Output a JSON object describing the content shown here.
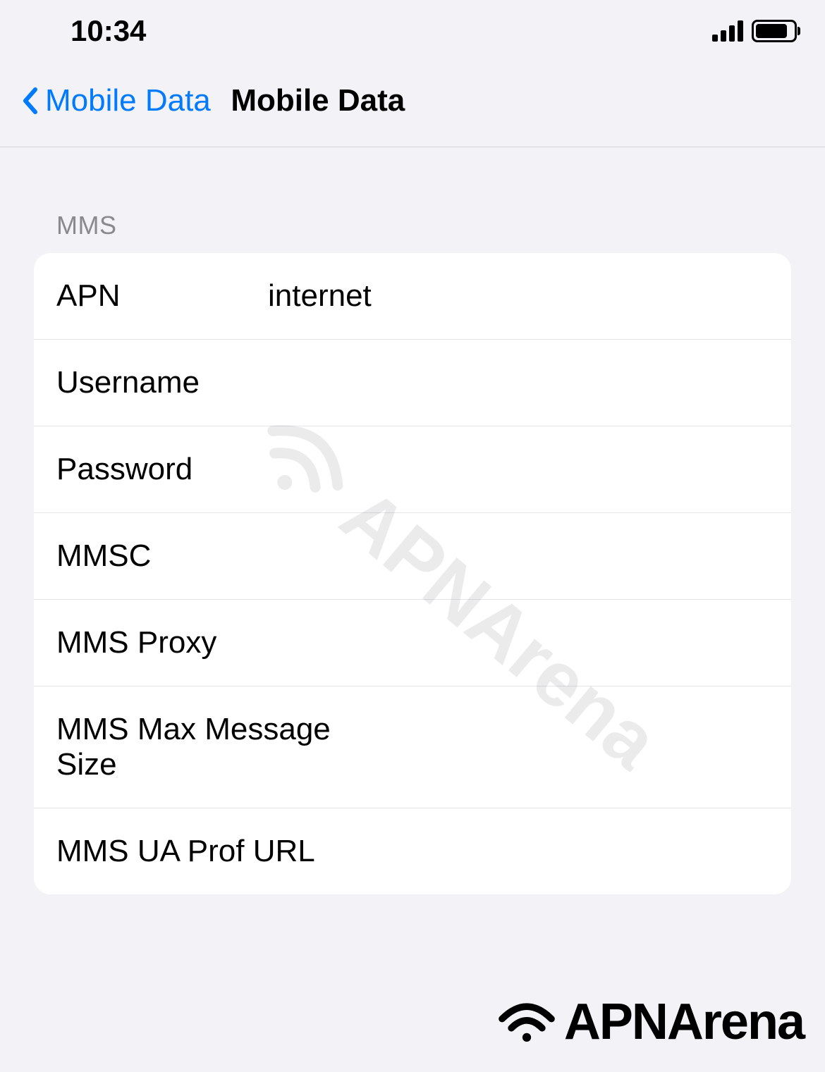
{
  "status_bar": {
    "time": "10:34"
  },
  "nav": {
    "back_label": "Mobile Data",
    "title": "Mobile Data"
  },
  "section": {
    "header": "MMS",
    "rows": [
      {
        "label": "APN",
        "value": "internet"
      },
      {
        "label": "Username",
        "value": ""
      },
      {
        "label": "Password",
        "value": ""
      },
      {
        "label": "MMSC",
        "value": ""
      },
      {
        "label": "MMS Proxy",
        "value": ""
      },
      {
        "label": "MMS Max Message Size",
        "value": ""
      },
      {
        "label": "MMS UA Prof URL",
        "value": ""
      }
    ]
  },
  "watermark": {
    "text": "APNArena"
  },
  "footer": {
    "brand": "APNArena"
  }
}
